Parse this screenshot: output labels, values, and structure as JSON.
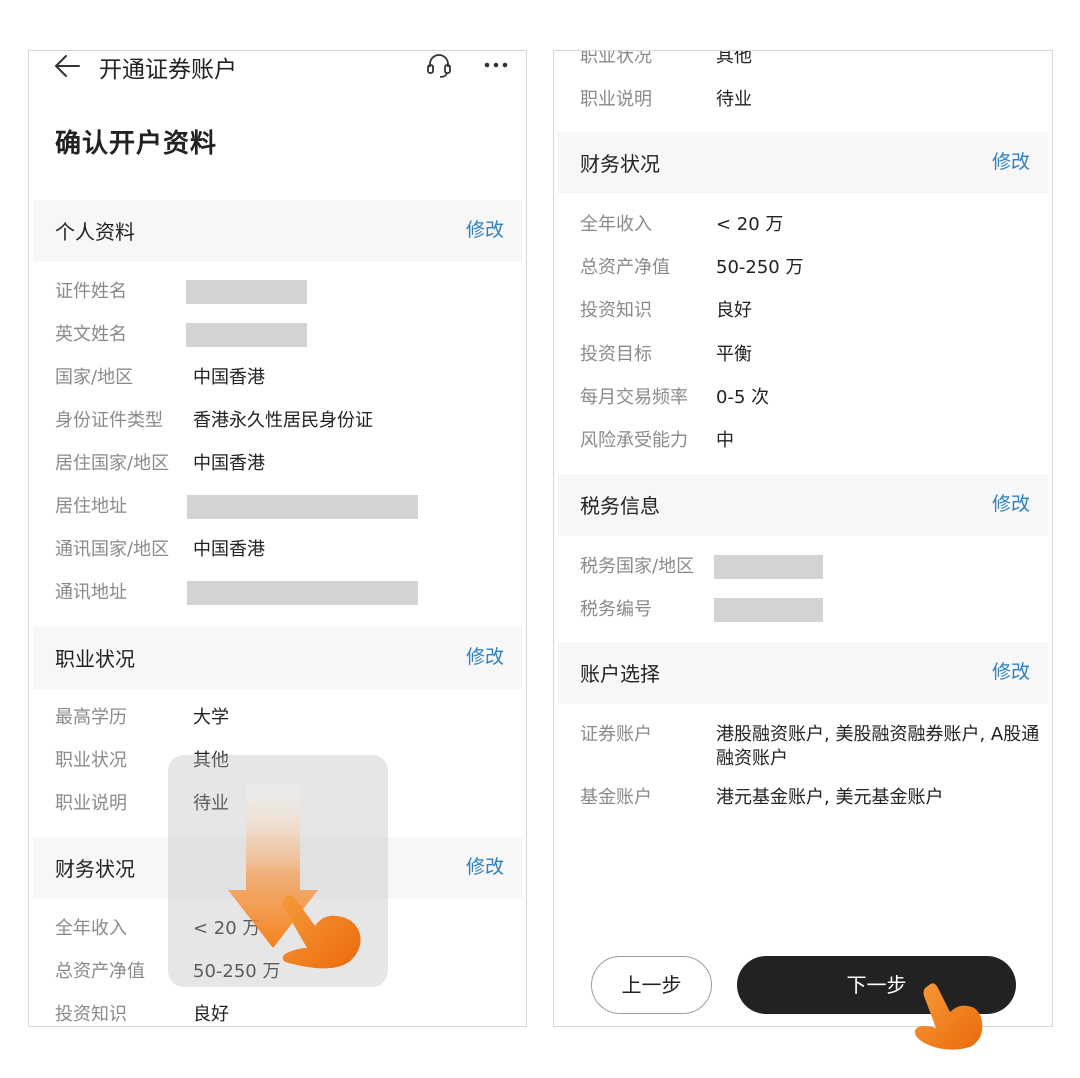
{
  "header": {
    "title": "开通证券账户",
    "back_icon": "back-arrow-icon",
    "support_icon": "headset-icon",
    "more_icon": "more-icon"
  },
  "page_title": "确认开户资料",
  "left": {
    "personal": {
      "title": "个人资料",
      "edit": "修改",
      "rows": [
        {
          "label": "证件姓名",
          "value": ""
        },
        {
          "label": "英文姓名",
          "value": ""
        },
        {
          "label": "国家/地区",
          "value": "中国香港"
        },
        {
          "label": "身份证件类型",
          "value": "香港永久性居民身份证"
        },
        {
          "label": "居住国家/地区",
          "value": "中国香港"
        },
        {
          "label": "居住地址",
          "value": ""
        },
        {
          "label": "通讯国家/地区",
          "value": "中国香港"
        },
        {
          "label": "通讯地址",
          "value": ""
        }
      ]
    },
    "occupation": {
      "title": "职业状况",
      "edit": "修改",
      "rows": [
        {
          "label": "最高学历",
          "value": "大学"
        },
        {
          "label": "职业状况",
          "value": "其他"
        },
        {
          "label": "职业说明",
          "value": "待业"
        }
      ]
    },
    "finance": {
      "title": "财务状况",
      "edit": "修改",
      "rows": [
        {
          "label": "全年收入",
          "value": "< 20 万"
        },
        {
          "label": "总资产净值",
          "value": "50-250 万"
        },
        {
          "label": "投资知识",
          "value": "良好"
        }
      ]
    }
  },
  "right": {
    "occupation_tail": [
      {
        "label": "职业状况",
        "value": "其他"
      },
      {
        "label": "职业说明",
        "value": "待业"
      }
    ],
    "finance": {
      "title": "财务状况",
      "edit": "修改",
      "rows": [
        {
          "label": "全年收入",
          "value": "< 20 万"
        },
        {
          "label": "总资产净值",
          "value": "50-250 万"
        },
        {
          "label": "投资知识",
          "value": "良好"
        },
        {
          "label": "投资目标",
          "value": "平衡"
        },
        {
          "label": "每月交易频率",
          "value": "0-5 次"
        },
        {
          "label": "风险承受能力",
          "value": "中"
        }
      ]
    },
    "tax": {
      "title": "税务信息",
      "edit": "修改",
      "rows": [
        {
          "label": "税务国家/地区",
          "value": ""
        },
        {
          "label": "税务编号",
          "value": ""
        }
      ]
    },
    "account": {
      "title": "账户选择",
      "edit": "修改",
      "rows": [
        {
          "label": "证券账户",
          "value": "港股融资账户, 美股融资融券账户, A股通融资账户"
        },
        {
          "label": "基金账户",
          "value": "港元基金账户, 美元基金账户"
        }
      ]
    }
  },
  "buttons": {
    "prev": "上一步",
    "next": "下一步"
  },
  "gesture": {
    "swipe_icon": "swipe-down-arrow-icon",
    "hand_icon": "tap-hand-icon",
    "accent": "#f57a0f"
  },
  "colors": {
    "link": "#2f7fc1",
    "band": "#f7f7f7",
    "next_button": "#222222"
  }
}
